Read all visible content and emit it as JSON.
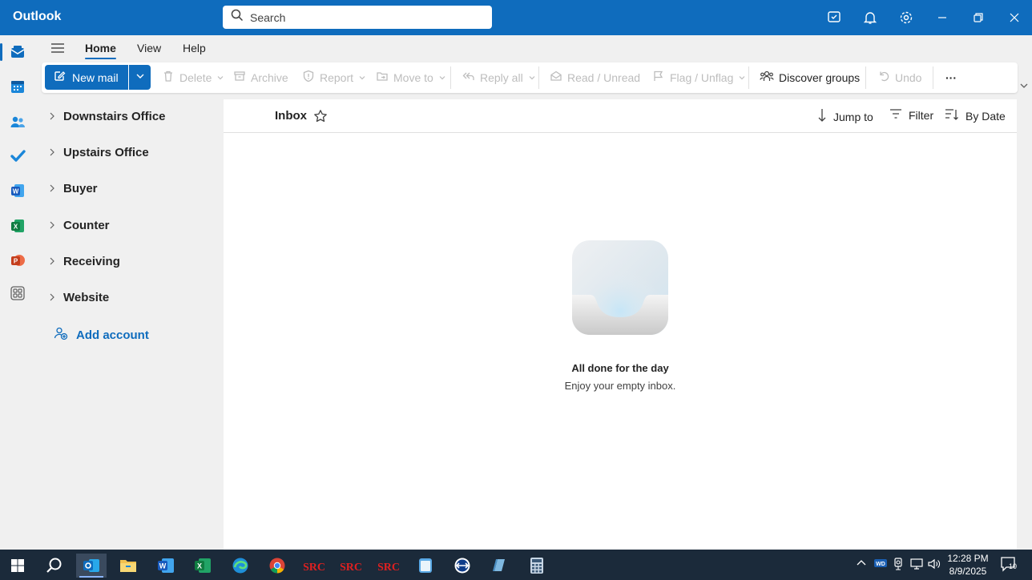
{
  "app": {
    "name": "Outlook"
  },
  "search": {
    "placeholder": "Search"
  },
  "ribbon_tabs": [
    {
      "label": "Home",
      "active": true
    },
    {
      "label": "View",
      "active": false
    },
    {
      "label": "Help",
      "active": false
    }
  ],
  "toolbar": {
    "new_mail": "New mail",
    "delete": "Delete",
    "archive": "Archive",
    "report": "Report",
    "move_to": "Move to",
    "reply_all": "Reply all",
    "read_unread": "Read / Unread",
    "flag_unflag": "Flag / Unflag",
    "discover_groups": "Discover groups",
    "undo": "Undo",
    "more": "···"
  },
  "folders": [
    {
      "label": "Downstairs Office"
    },
    {
      "label": "Upstairs Office"
    },
    {
      "label": "Buyer"
    },
    {
      "label": "Counter"
    },
    {
      "label": "Receiving"
    },
    {
      "label": "Website"
    }
  ],
  "add_account": "Add account",
  "list": {
    "title": "Inbox",
    "jump_to": "Jump to",
    "filter": "Filter",
    "sort": "By Date",
    "empty_title": "All done for the day",
    "empty_subtitle": "Enjoy your empty inbox."
  },
  "taskbar": {
    "time": "12:28 PM",
    "date": "8/9/2025",
    "notifications": "10"
  },
  "colors": {
    "accent": "#0f6cbd",
    "taskbar": "#1b2a3a"
  }
}
